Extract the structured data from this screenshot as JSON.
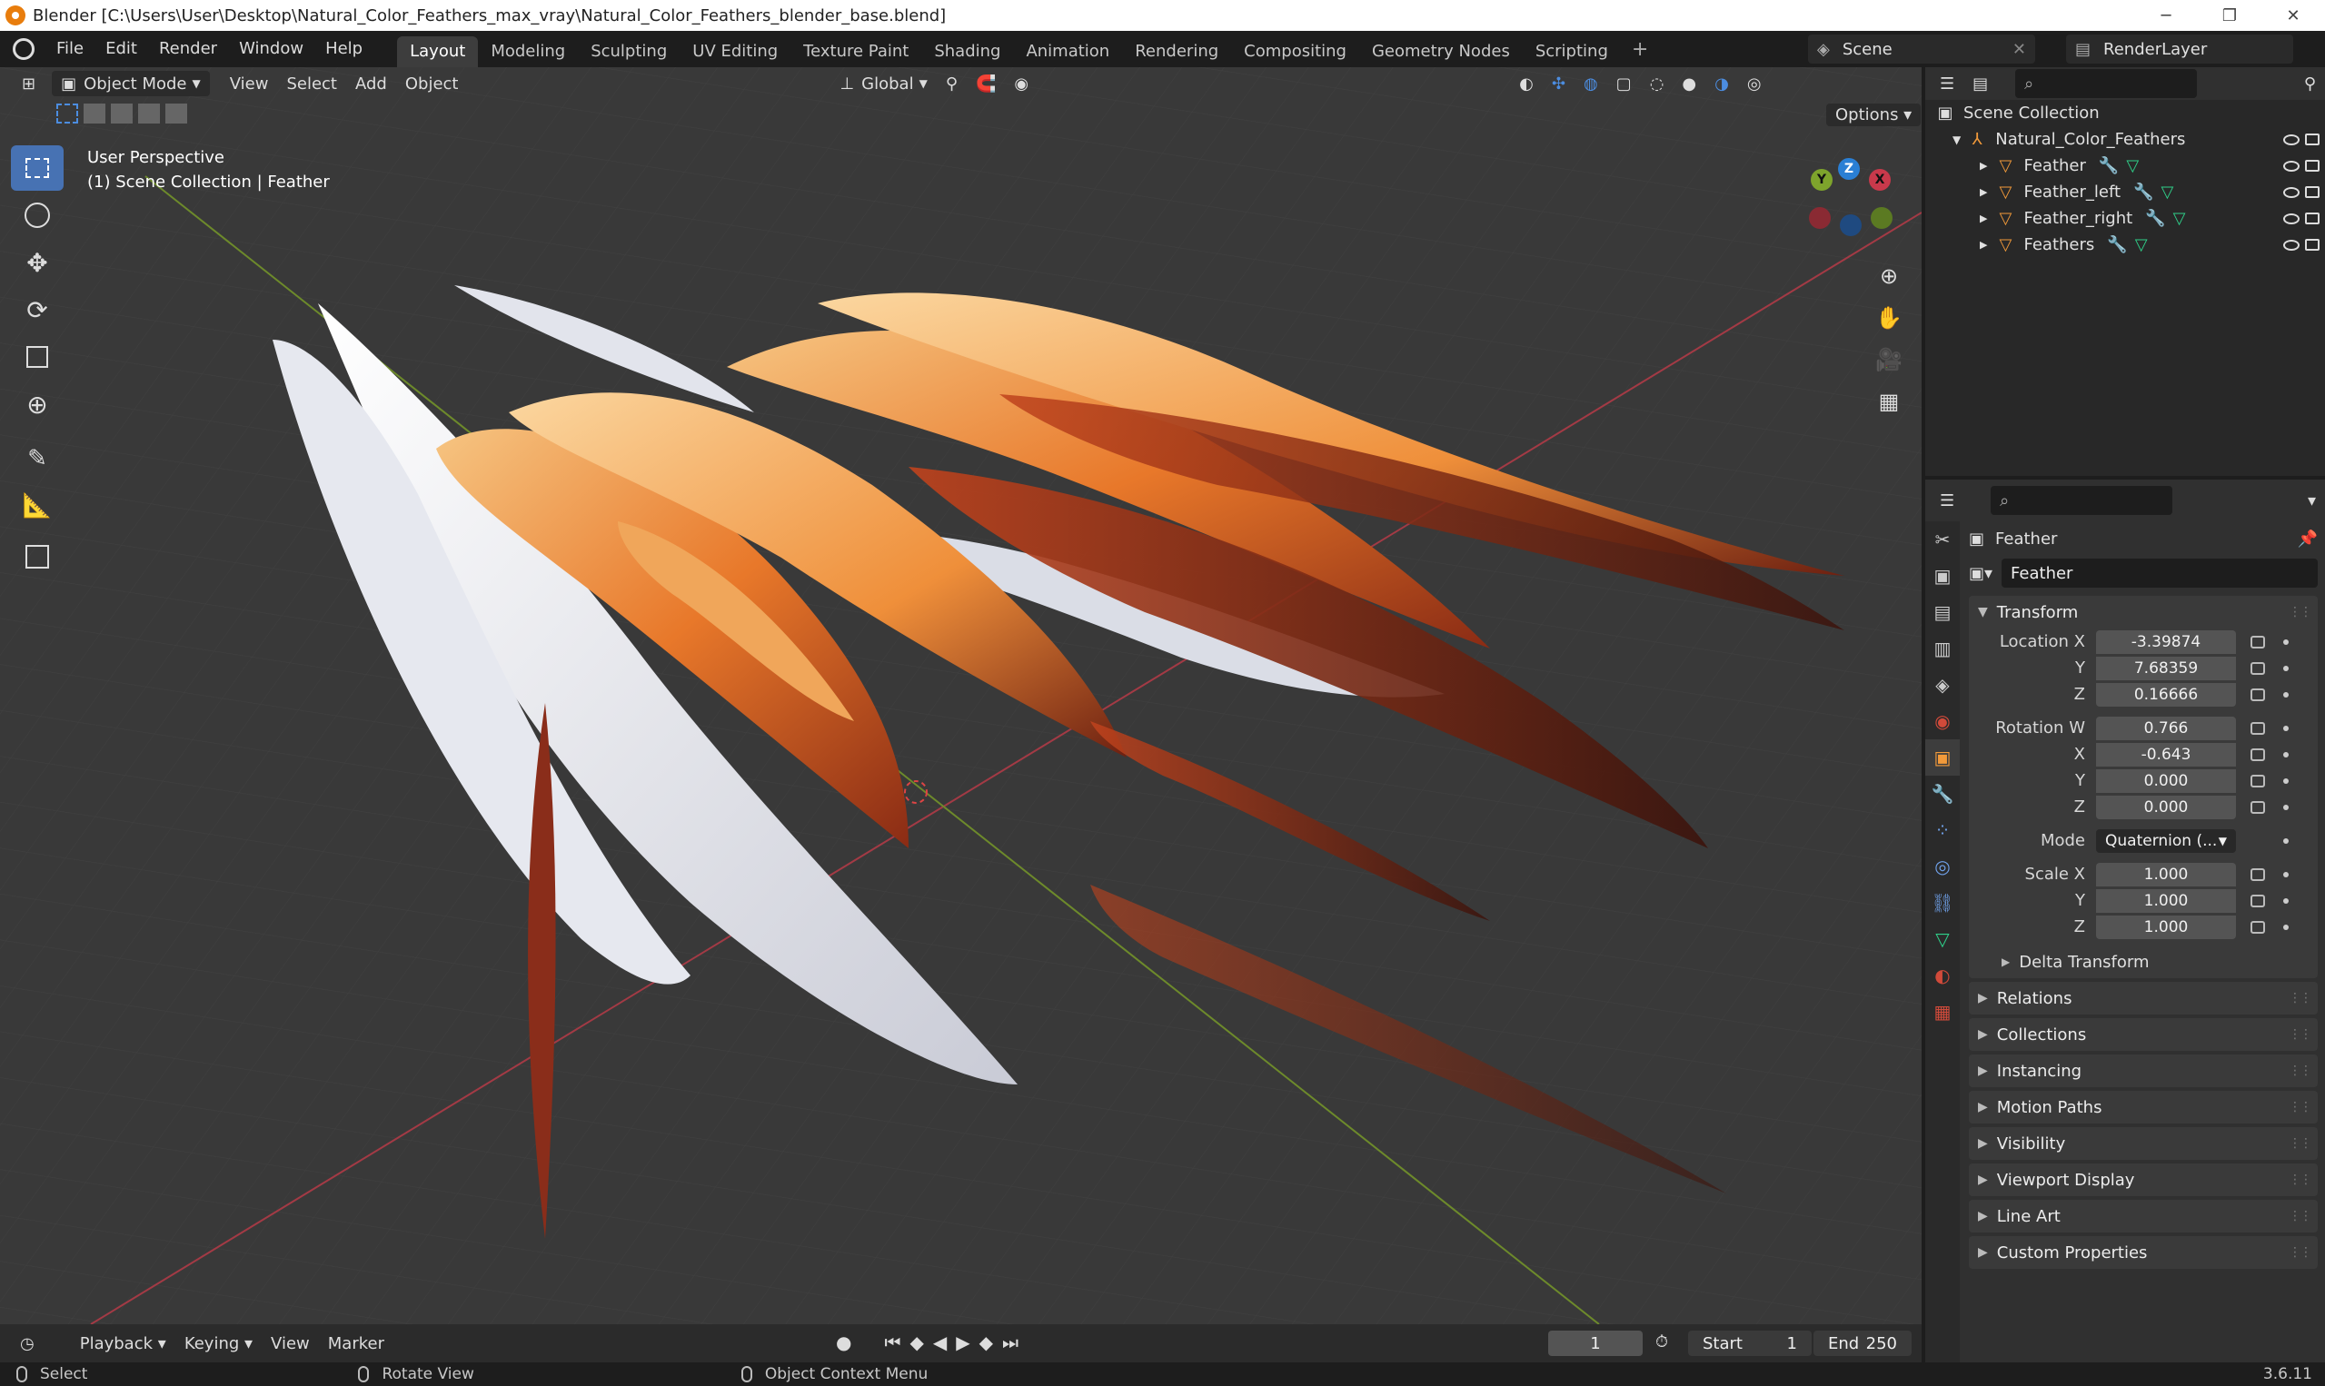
{
  "window": {
    "title": "Blender [C:\\Users\\User\\Desktop\\Natural_Color_Feathers_max_vray\\Natural_Color_Feathers_blender_base.blend]",
    "minimize": "─",
    "maximize": "❐",
    "close": "✕"
  },
  "menu": [
    "File",
    "Edit",
    "Render",
    "Window",
    "Help"
  ],
  "workspaces": [
    {
      "label": "Layout",
      "active": true
    },
    {
      "label": "Modeling"
    },
    {
      "label": "Sculpting"
    },
    {
      "label": "UV Editing"
    },
    {
      "label": "Texture Paint"
    },
    {
      "label": "Shading"
    },
    {
      "label": "Animation"
    },
    {
      "label": "Rendering"
    },
    {
      "label": "Compositing"
    },
    {
      "label": "Geometry Nodes"
    },
    {
      "label": "Scripting"
    }
  ],
  "workspace_add": "+",
  "scene": {
    "name": "Scene",
    "render_layer": "RenderLayer"
  },
  "viewport": {
    "mode": "Object Mode",
    "menus": [
      "View",
      "Select",
      "Add",
      "Object"
    ],
    "orientation": "Global",
    "options": "Options",
    "overlay_line1": "User Perspective",
    "overlay_line2": "(1) Scene Collection | Feather",
    "gizmo": {
      "x": "X",
      "y": "Y",
      "z": "Z"
    },
    "colors": {
      "x_axis": "#c9394b",
      "y_axis": "#7ea42c",
      "z_axis": "#2a7fd4",
      "active_tool": "#4772b3"
    }
  },
  "timeline": {
    "menus": [
      "Playback",
      "Keying",
      "View",
      "Marker"
    ],
    "current_frame": "1",
    "start_label": "Start",
    "start": "1",
    "end_label": "End",
    "end": "250"
  },
  "statusbar": {
    "select": "Select",
    "rotate": "Rotate View",
    "context": "Object Context Menu",
    "version": "3.6.11"
  },
  "outliner": {
    "root": "Scene Collection",
    "collection": "Natural_Color_Feathers",
    "objects": [
      "Feather",
      "Feather_left",
      "Feather_right",
      "Feathers"
    ]
  },
  "properties": {
    "object_name": "Feather",
    "datablock_name": "Feather",
    "transform_label": "Transform",
    "location": {
      "label": "Location X",
      "x": "-3.39874",
      "y": "7.68359",
      "z": "0.16666"
    },
    "rotation": {
      "label": "Rotation W",
      "w": "0.766",
      "x": "-0.643",
      "y": "0.000",
      "z": "0.000"
    },
    "mode_label": "Mode",
    "mode_value": "Quaternion (...",
    "scale": {
      "label": "Scale X",
      "x": "1.000",
      "y": "1.000",
      "z": "1.000"
    },
    "axis_y": "Y",
    "axis_z": "Z",
    "axis_x": "X",
    "delta": "Delta Transform",
    "panels": [
      "Relations",
      "Collections",
      "Instancing",
      "Motion Paths",
      "Visibility",
      "Viewport Display",
      "Line Art",
      "Custom Properties"
    ]
  }
}
